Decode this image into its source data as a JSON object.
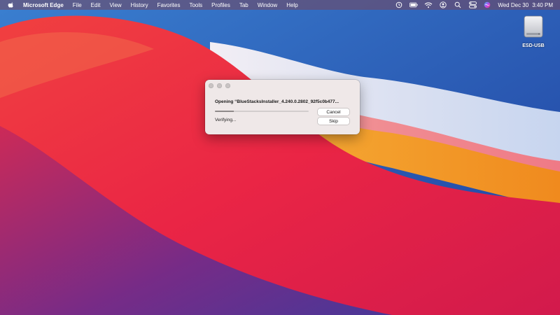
{
  "menubar": {
    "apple_icon": "apple-logo-icon",
    "app_name": "Microsoft Edge",
    "menus": [
      "File",
      "Edit",
      "View",
      "History",
      "Favorites",
      "Tools",
      "Profiles",
      "Tab",
      "Window",
      "Help"
    ],
    "status_icons": [
      "time-machine-icon",
      "battery-icon",
      "wifi-icon",
      "user-icon",
      "spotlight-icon",
      "control-center-icon",
      "siri-icon"
    ],
    "date": "Wed Dec 30",
    "time": "3:40 PM"
  },
  "desktop": {
    "drive": {
      "label": "ESD-USB",
      "icon": "external-drive-icon"
    }
  },
  "dialog": {
    "title": "Opening “BlueStacksInstaller_4.240.0.2802_92f5c0b477...",
    "status": "Verifying...",
    "progress": 0.2,
    "cancel_label": "Cancel",
    "skip_label": "Skip"
  },
  "colors": {
    "menubar_text": "#ffffff",
    "dialog_bg": "#efe8e8",
    "wallpaper_blue": "#2a57b8",
    "wallpaper_red": "#e8283c",
    "wallpaper_orange": "#f59a1c",
    "wallpaper_purple": "#5a2a8a"
  }
}
